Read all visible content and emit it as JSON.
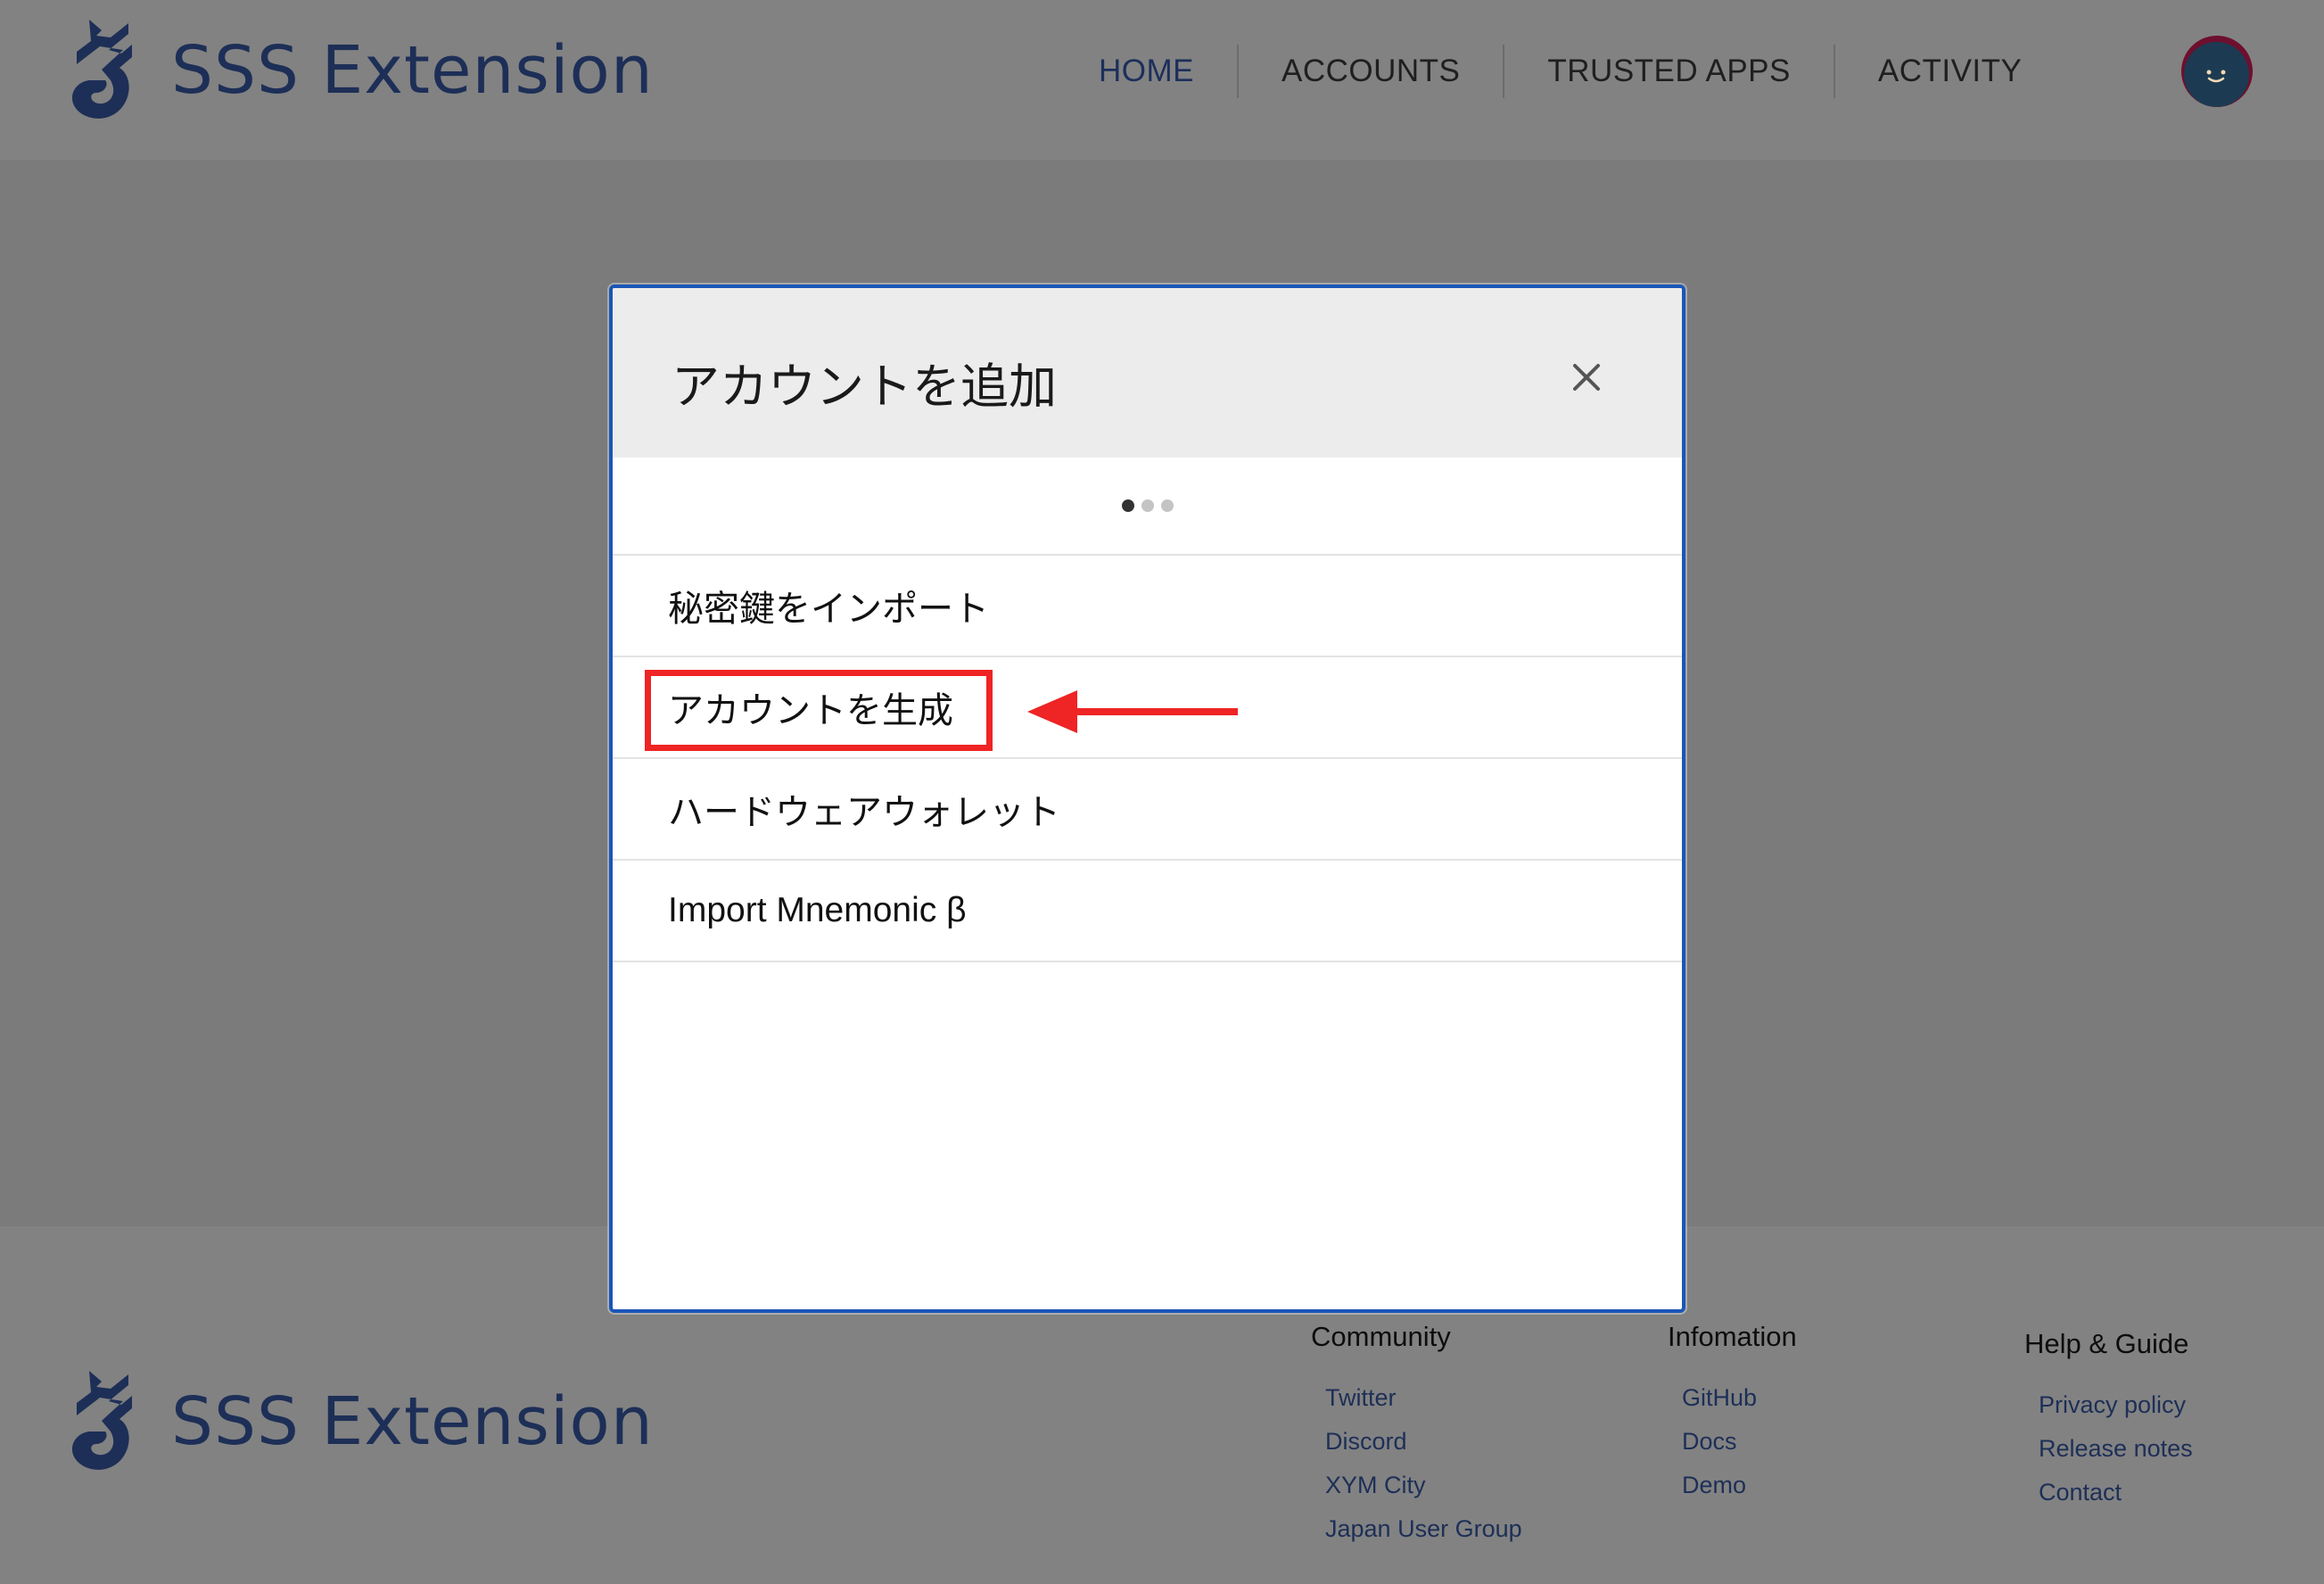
{
  "header": {
    "logo_text": "SSS Extension",
    "nav": [
      {
        "label": "HOME",
        "active": true
      },
      {
        "label": "ACCOUNTS",
        "active": false
      },
      {
        "label": "TRUSTED APPS",
        "active": false
      },
      {
        "label": "ACTIVITY",
        "active": false
      }
    ]
  },
  "modal": {
    "title": "アカウントを追加",
    "close_icon": "close-icon",
    "steps": {
      "total": 3,
      "current": 1
    },
    "items": [
      {
        "label": "秘密鍵をインポート"
      },
      {
        "label": "アカウントを生成",
        "highlighted": true
      },
      {
        "label": "ハードウェアウォレット"
      },
      {
        "label": "Import Mnemonic β"
      }
    ]
  },
  "footer": {
    "logo_text": "SSS Extension",
    "columns": [
      {
        "heading": "Community",
        "links": [
          "Twitter",
          "Discord",
          "XYM City",
          "Japan User Group"
        ]
      },
      {
        "heading": "Infomation",
        "links": [
          "GitHub",
          "Docs",
          "Demo"
        ]
      },
      {
        "heading": "Help & Guide",
        "links": [
          "Privacy policy",
          "Release notes",
          "Contact"
        ]
      }
    ]
  },
  "colors": {
    "brand": "#1d2f57",
    "modal_border": "#1a56b8",
    "annotation": "#ef2424",
    "overlay": "#7b7b7b"
  }
}
